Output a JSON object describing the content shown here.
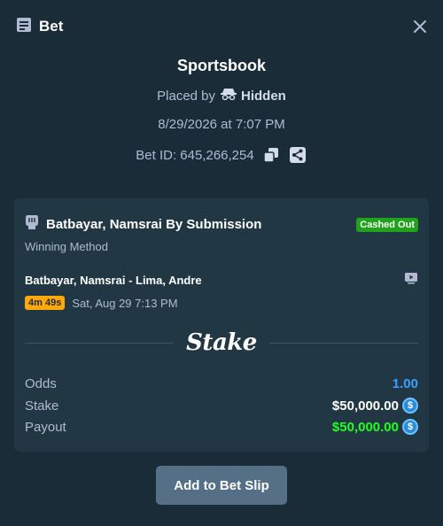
{
  "header": {
    "title": "Bet",
    "icon": "receipt-icon",
    "close_icon": "close-icon"
  },
  "info": {
    "book": "Sportsbook",
    "placed_by_label": "Placed by",
    "placed_by_name": "Hidden",
    "date": "8/29/2026 at 7:07 PM",
    "bet_id": "Bet ID: 645,266,254"
  },
  "card": {
    "selection": "Batbayar, Namsrai By Submission",
    "status": "Cashed Out",
    "market": "Winning Method",
    "event": "Batbayar, Namsrai - Lima, Andre",
    "live_time": "4m 49s",
    "event_time": "Sat, Aug 29   7:13 PM",
    "logo": "Stake",
    "odds_label": "Odds",
    "odds_value": "1.00",
    "stake_label": "Stake",
    "stake_value": "$50,000.00",
    "payout_label": "Payout",
    "payout_value": "$50,000.00",
    "currency_icon": "usd-coin-icon"
  },
  "add_button": "Add to Bet Slip",
  "colors": {
    "background": "#1a2c38",
    "card": "#213743",
    "status_green": "#1fa31a",
    "odds_blue": "#3d9fff",
    "payout_green": "#1fff20",
    "live_orange": "#ffa908"
  }
}
